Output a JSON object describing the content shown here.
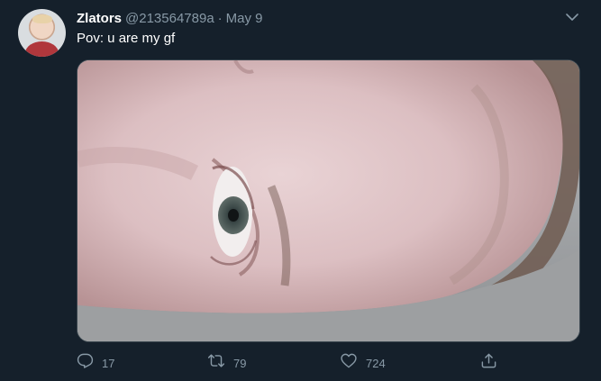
{
  "tweet": {
    "author": {
      "name": "Zlators",
      "handle": "@213564789a",
      "separator": "·",
      "date": "May 9"
    },
    "text": "Pov: u are my gf",
    "media": {
      "description_icon": "photo"
    },
    "actions": {
      "reply_count": "17",
      "retweet_count": "79",
      "like_count": "724"
    }
  },
  "colors": {
    "background": "#15202b",
    "secondary_text": "#8899a6",
    "primary_text": "#ffffff",
    "border": "#38444d"
  },
  "icons": {
    "reply": "reply-icon",
    "retweet": "retweet-icon",
    "like": "heart-icon",
    "share": "share-icon",
    "menu": "chevron-down-icon"
  }
}
